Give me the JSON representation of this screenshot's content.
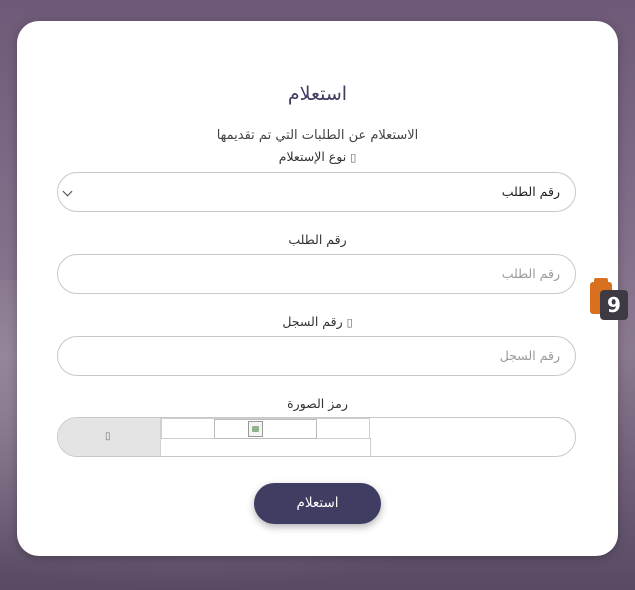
{
  "form": {
    "title": "استعلام",
    "subtitle": "الاستعلام عن الطلبات التي تم تقديمها",
    "inquiry_type": {
      "label": "نوع الإستعلام",
      "selected": "رقم الطلب"
    },
    "request_number": {
      "label": "رقم الطلب",
      "placeholder": "رقم الطلب"
    },
    "record_number": {
      "label": "رقم السجل",
      "placeholder": "رقم السجل"
    },
    "captcha": {
      "label": "رمز الصورة"
    },
    "submit_label": "استعلام"
  },
  "side_widget": {
    "text": "9"
  },
  "colors": {
    "accent": "#3f3d62",
    "widget_orange": "#d8701f"
  },
  "icons": {
    "info": "info-icon",
    "refresh": "refresh-icon",
    "dropdown": "chevron-down-icon",
    "broken_image": "broken-image-icon"
  }
}
